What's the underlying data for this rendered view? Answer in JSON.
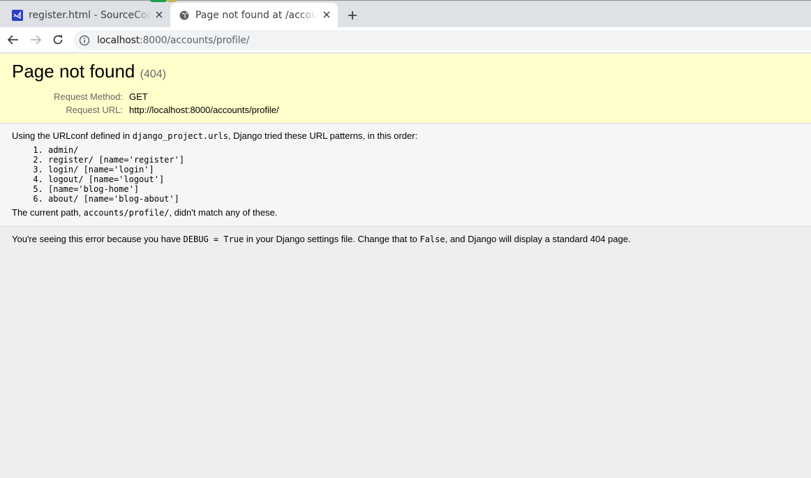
{
  "tabs": [
    {
      "title": "register.html - SourceCode",
      "active": false,
      "favicon": "visual-studio-code-icon"
    },
    {
      "title": "Page not found at /accounts/profile/",
      "active": true,
      "favicon": "globe-icon"
    }
  ],
  "toolbar": {
    "url_host": "localhost",
    "url_path": ":8000/accounts/profile/"
  },
  "error": {
    "title": "Page not found",
    "code": "(404)",
    "meta": [
      {
        "key": "Request Method:",
        "value": "GET"
      },
      {
        "key": "Request URL:",
        "value": "http://localhost:8000/accounts/profile/"
      }
    ],
    "urlconf_prefix": "Using the URLconf defined in ",
    "urlconf_name": "django_project.urls",
    "urlconf_suffix": ", Django tried these URL patterns, in this order:",
    "patterns": [
      "admin/",
      "register/ [name='register']",
      "login/ [name='login']",
      "logout/ [name='logout']",
      "[name='blog-home']",
      "about/ [name='blog-about']"
    ],
    "current_prefix": "The current path, ",
    "current_path": "accounts/profile/",
    "current_suffix": ", didn't match any of these.",
    "debug_prefix": "You're seeing this error because you have ",
    "debug_setting": "DEBUG = True",
    "debug_middle": " in your Django settings file. Change that to ",
    "debug_false": "False",
    "debug_suffix": ", and Django will display a standard 404 page."
  },
  "colors": {
    "summary_bg": "#ffffcc",
    "info_bg": "#f6f6f6",
    "page_bg": "#eeeeee",
    "vscode_blue": "#2b3fc4"
  }
}
